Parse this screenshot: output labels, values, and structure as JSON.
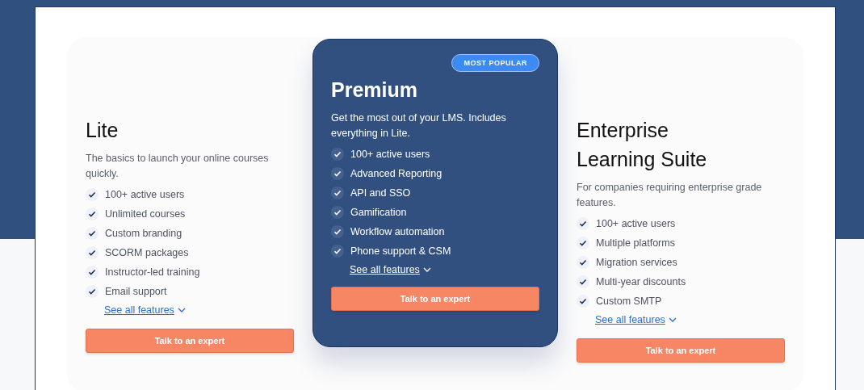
{
  "plans": [
    {
      "name": "Lite",
      "featured": false,
      "description": "The basics to launch your online courses quickly.",
      "features": [
        "100+ active users",
        "Unlimited courses",
        "Custom branding",
        "SCORM packages",
        "Instructor-led training",
        "Email support"
      ],
      "link": "See all features",
      "button": "Talk to an expert"
    },
    {
      "name": "Premium",
      "featured": true,
      "badge": "MOST POPULAR",
      "description": "Get the most out of your LMS. Includes everything in Lite.",
      "features": [
        "100+ active users",
        "Advanced Reporting",
        "API and SSO",
        "Gamification",
        "Workflow automation",
        "Phone support & CSM"
      ],
      "link": "See all features",
      "button": "Talk to an expert"
    },
    {
      "name": "Enterprise Learning Suite",
      "featured": false,
      "description": "For companies requiring enterprise grade features.",
      "features": [
        "100+ active users",
        "Multiple platforms",
        "Migration services",
        "Multi-year discounts",
        "Custom SMTP"
      ],
      "link": "See all features",
      "button": "Talk to an expert"
    }
  ]
}
